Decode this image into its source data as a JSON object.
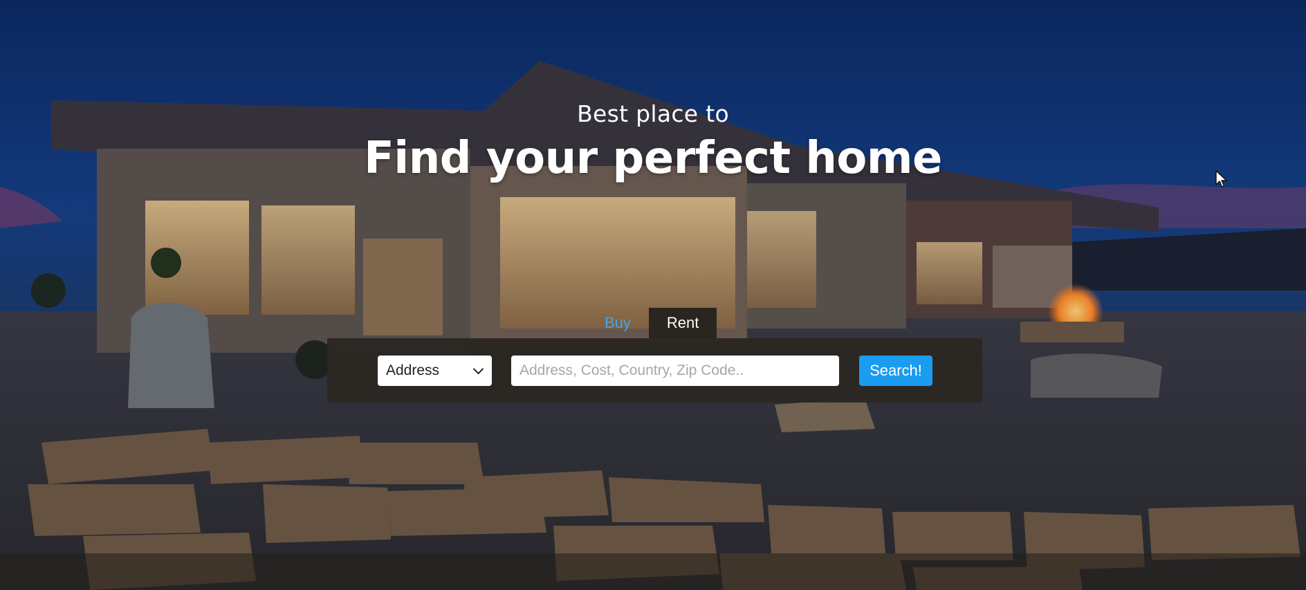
{
  "hero": {
    "subtitle": "Best place to",
    "title": "Find your perfect home"
  },
  "tabs": [
    {
      "label": "Buy",
      "active": true
    },
    {
      "label": "Rent",
      "active": false
    }
  ],
  "search": {
    "select_value": "Address",
    "placeholder": "Address, Cost, Country, Zip Code..",
    "button_label": "Search!"
  },
  "colors": {
    "accent": "#1a9cf0",
    "active_tab_text": "#4aa3e8",
    "panel_bg": "#2b2621"
  }
}
